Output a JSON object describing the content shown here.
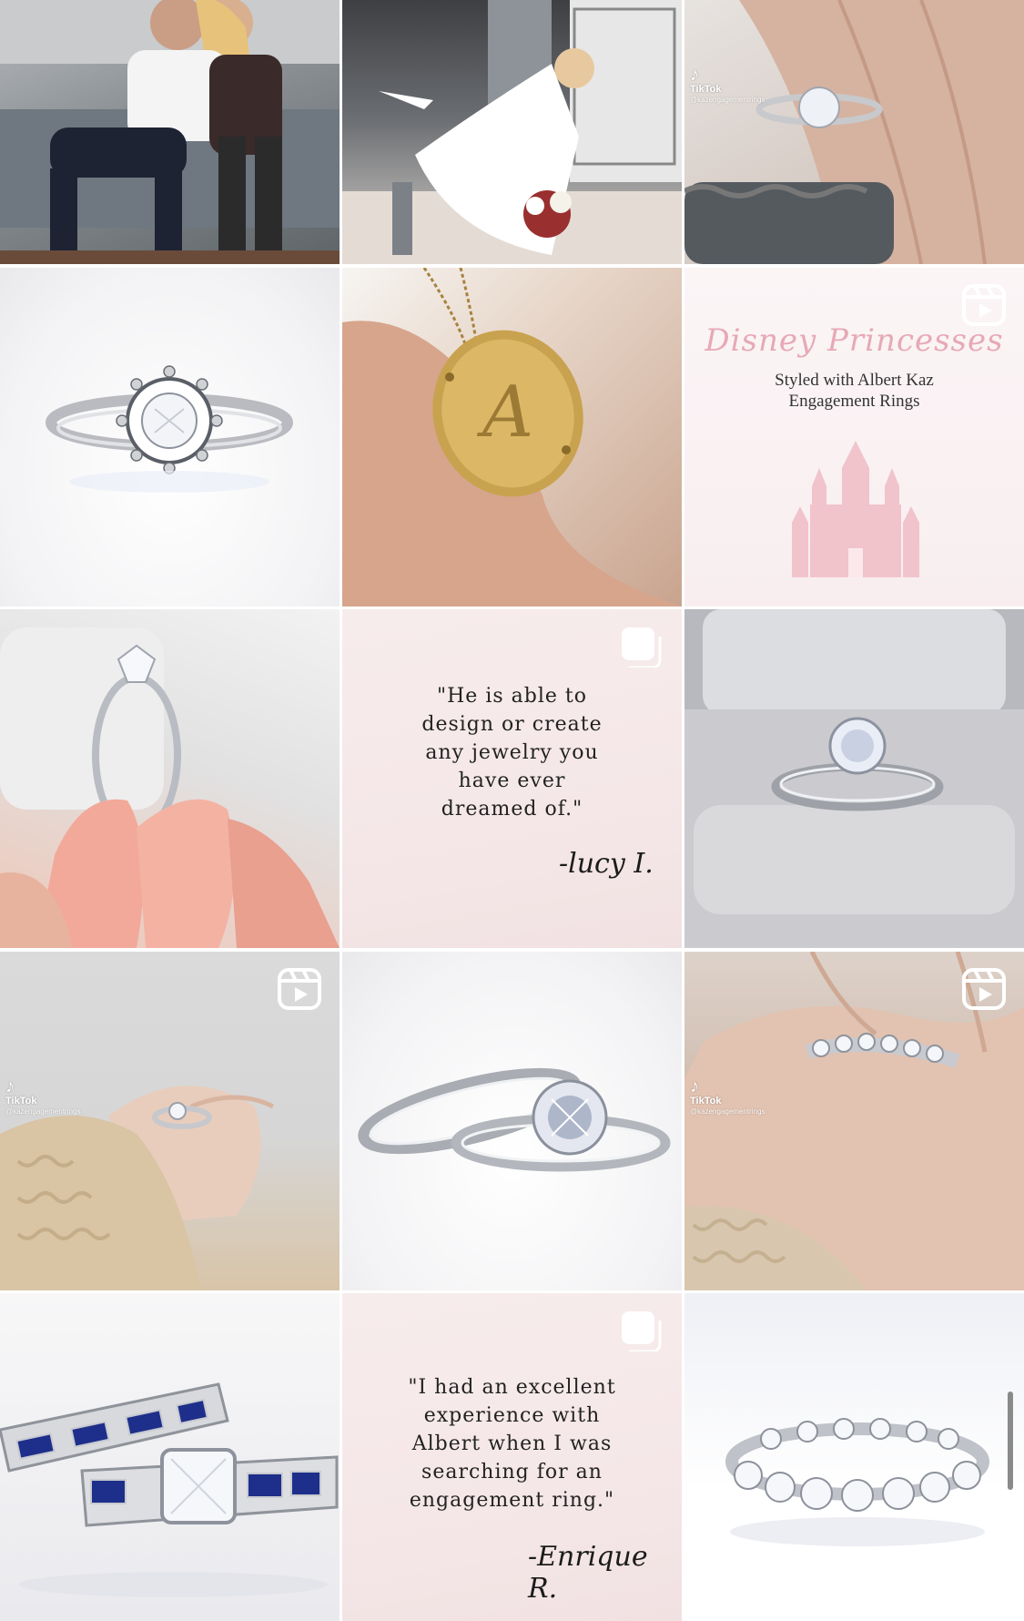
{
  "grid": {
    "tiles": [
      {
        "id": "couple-sofa",
        "type": "photo"
      },
      {
        "id": "wedding-dip",
        "type": "photo"
      },
      {
        "id": "solitaire-on-hand",
        "type": "video",
        "overlay": "tiktok"
      },
      {
        "id": "halo-ring",
        "type": "photo"
      },
      {
        "id": "gold-initial-pendant",
        "type": "photo"
      },
      {
        "id": "disney-princesses",
        "type": "reel"
      },
      {
        "id": "ring-held-nails",
        "type": "photo"
      },
      {
        "id": "quote-lucy",
        "type": "carousel"
      },
      {
        "id": "ring-in-box",
        "type": "photo"
      },
      {
        "id": "ring-sweater-hand",
        "type": "reel",
        "overlay": "tiktok"
      },
      {
        "id": "bridal-set",
        "type": "photo"
      },
      {
        "id": "eternity-on-finger",
        "type": "reel",
        "overlay": "tiktok"
      },
      {
        "id": "sapphire-set",
        "type": "photo"
      },
      {
        "id": "quote-enrique",
        "type": "carousel"
      },
      {
        "id": "eternity-band",
        "type": "photo"
      }
    ]
  },
  "tiktok": {
    "name": "TikTok",
    "handle": "@kazengagementrings",
    "logo": "♪"
  },
  "disney": {
    "script_title": "Disney Princesses",
    "subtitle_line1": "Styled with Albert Kaz",
    "subtitle_line2": "Engagement Rings"
  },
  "quote_lucy": {
    "line1": "\"He is able to",
    "line2": "design or create",
    "line3": "any jewelry you",
    "line4": "have ever",
    "line5": "dreamed of.\"",
    "signature": "-lucy I."
  },
  "quote_enrique": {
    "line1": "\"I had an excellent",
    "line2": "experience with",
    "line3": "Albert when I was",
    "line4": "searching for an",
    "line5": "engagement ring.\"",
    "signature": "-Enrique R."
  },
  "pendant": {
    "initial": "A"
  },
  "colors": {
    "background": "#ffffff",
    "pink_text": "#e7a9b5",
    "sapphire": "#1d2f8a",
    "gold": "#c9a24f"
  },
  "icons": {
    "reel": "reels-icon",
    "carousel": "carousel-icon"
  }
}
